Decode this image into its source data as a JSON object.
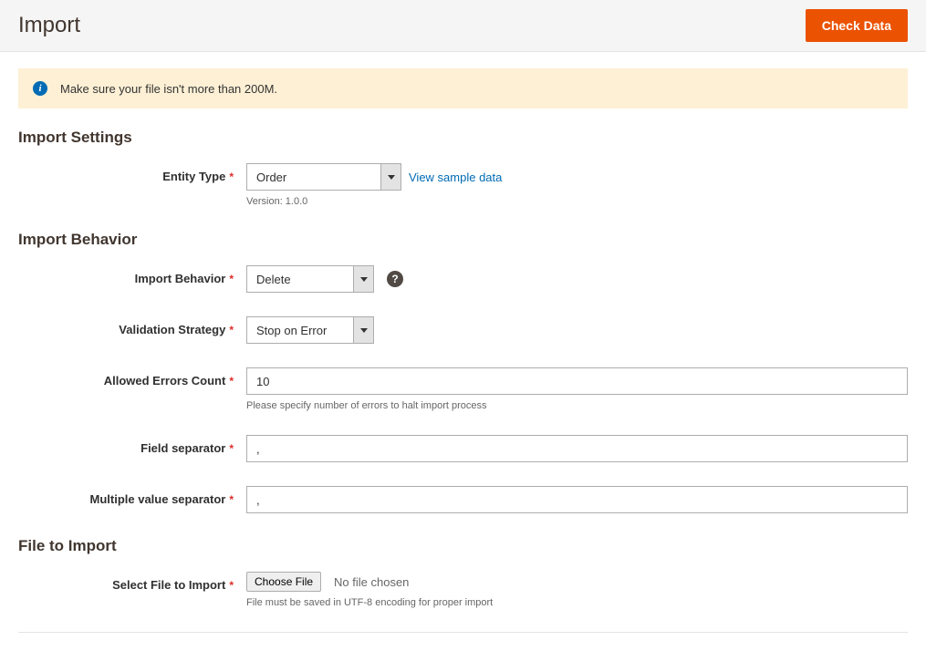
{
  "header": {
    "title": "Import",
    "check_data_label": "Check Data"
  },
  "alert": {
    "message": "Make sure your file isn't more than 200M."
  },
  "sections": {
    "import_settings": "Import Settings",
    "import_behavior": "Import Behavior",
    "file_to_import": "File to Import"
  },
  "fields": {
    "entity_type": {
      "label": "Entity Type",
      "value": "Order",
      "sample_link": "View sample data",
      "version": "Version: 1.0.0"
    },
    "import_behavior": {
      "label": "Import Behavior",
      "value": "Delete"
    },
    "validation_strategy": {
      "label": "Validation Strategy",
      "value": "Stop on Error"
    },
    "allowed_errors": {
      "label": "Allowed Errors Count",
      "value": "10",
      "help": "Please specify number of errors to halt import process"
    },
    "field_separator": {
      "label": "Field separator",
      "value": ","
    },
    "multi_separator": {
      "label": "Multiple value separator",
      "value": ","
    },
    "select_file": {
      "label": "Select File to Import",
      "button": "Choose File",
      "status": "No file chosen",
      "help": "File must be saved in UTF-8 encoding for proper import"
    }
  }
}
